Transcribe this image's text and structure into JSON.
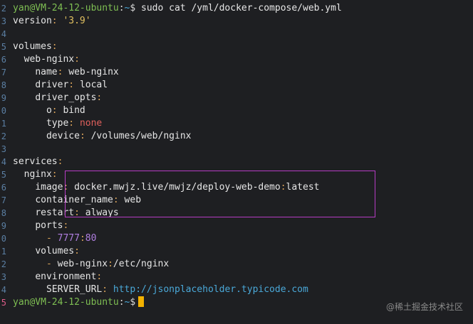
{
  "terminal": {
    "prompt_user_host": "yan@VM-24-12-ubuntu",
    "prompt_sep": ":",
    "prompt_path": "~",
    "prompt_symbol": "$",
    "command": "sudo cat /yml/docker-compose/web.yml",
    "gutter_numbers": [
      "2",
      "3",
      "4",
      "5",
      "6",
      "7",
      "8",
      "9",
      "0",
      "1",
      "2",
      "3",
      "4",
      "5",
      "6",
      "7",
      "8",
      "9",
      "0",
      "1",
      "2",
      "3",
      "4",
      "5"
    ],
    "yaml": {
      "version_key": "version",
      "version_val": "'3.9'",
      "volumes_key": "volumes",
      "web_nginx_key": "web-nginx",
      "name_key": "name",
      "name_val": "web-nginx",
      "driver_key": "driver",
      "driver_val": "local",
      "driver_opts_key": "driver_opts",
      "o_key": "o",
      "o_val": "bind",
      "type_key": "type",
      "type_val": "none",
      "device_key": "device",
      "device_val": "/volumes/web/nginx",
      "services_key": "services",
      "nginx_key": "nginx",
      "image_key": "image",
      "image_val_main": "docker.mwjz.live/mwjz/deploy-web-demo",
      "image_val_tag": "latest",
      "container_name_key": "container_name",
      "container_name_val": "web",
      "restart_key": "restart",
      "restart_val": "always",
      "ports_key": "ports",
      "port_host": "7777",
      "port_container": "80",
      "svc_volumes_key": "volumes",
      "volume_mount_src": "web-nginx",
      "volume_mount_dst": "/etc/nginx",
      "environment_key": "environment",
      "server_url_key": "SERVER_URL",
      "server_url_val": "http://jsonplaceholder.typicode.com"
    }
  },
  "watermark": "@稀土掘金技术社区",
  "colors": {
    "background": "#1e1f22",
    "prompt_user": "#7fbf53",
    "prompt_path": "#4aa8d8",
    "yaml_colon": "#d8a25a",
    "yaml_string": "#e0c060",
    "yaml_null": "#e0605c",
    "yaml_number": "#b07fe0",
    "url": "#4aa8d8",
    "cursor": "#f2b100",
    "highlight_box": "#b63cc4"
  }
}
